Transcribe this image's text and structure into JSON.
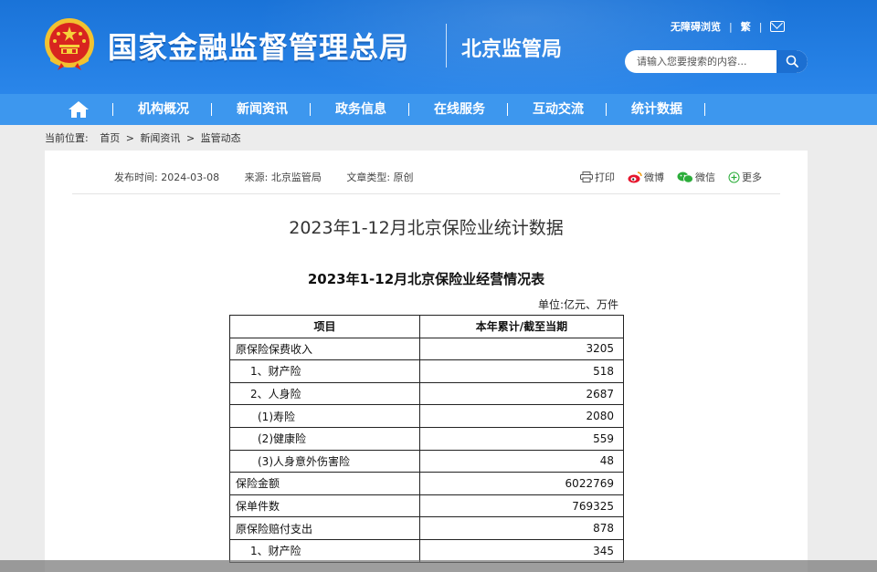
{
  "header": {
    "site_title": "国家金融监督管理总局",
    "branch_title": "北京监管局",
    "accessibility_label": "无障碍浏览",
    "traditional_label": "繁",
    "search_placeholder": "请输入您要搜索的内容..."
  },
  "nav": {
    "items": [
      {
        "label": "机构概况"
      },
      {
        "label": "新闻资讯"
      },
      {
        "label": "政务信息"
      },
      {
        "label": "在线服务"
      },
      {
        "label": "互动交流"
      },
      {
        "label": "统计数据"
      }
    ]
  },
  "breadcrumb": {
    "prefix": "当前位置:",
    "home": "首页",
    "sep": ">",
    "level1": "新闻资讯",
    "level2": "监管动态"
  },
  "article": {
    "publish_time": "发布时间: 2024-03-08",
    "source": "来源: 北京监管局",
    "type": "文章类型: 原创",
    "share": {
      "print": "打印",
      "weibo": "微博",
      "wechat": "微信",
      "more": "更多"
    },
    "title": "2023年1-12月北京保险业统计数据",
    "table_title": "2023年1-12月北京保险业经营情况表",
    "unit": "单位:亿元、万件",
    "table": {
      "headers": [
        "项目",
        "本年累计/截至当期"
      ],
      "rows": [
        {
          "item": "原保险保费收入",
          "value": "3205"
        },
        {
          "item": "1、财产险",
          "value": "518"
        },
        {
          "item": "2、人身险",
          "value": "2687"
        },
        {
          "item": "(1)寿险",
          "value": "2080"
        },
        {
          "item": "(2)健康险",
          "value": "559"
        },
        {
          "item": "(3)人身意外伤害险",
          "value": "48"
        },
        {
          "item": "保险金额",
          "value": "6022769"
        },
        {
          "item": "保单件数",
          "value": "769325"
        },
        {
          "item": "原保险赔付支出",
          "value": "878"
        },
        {
          "item": "1、财产险",
          "value": "345"
        }
      ]
    }
  },
  "colors": {
    "header_blue": "#1a73d8",
    "nav_blue": "#3d97ee",
    "search_button": "#1c6fd1"
  }
}
